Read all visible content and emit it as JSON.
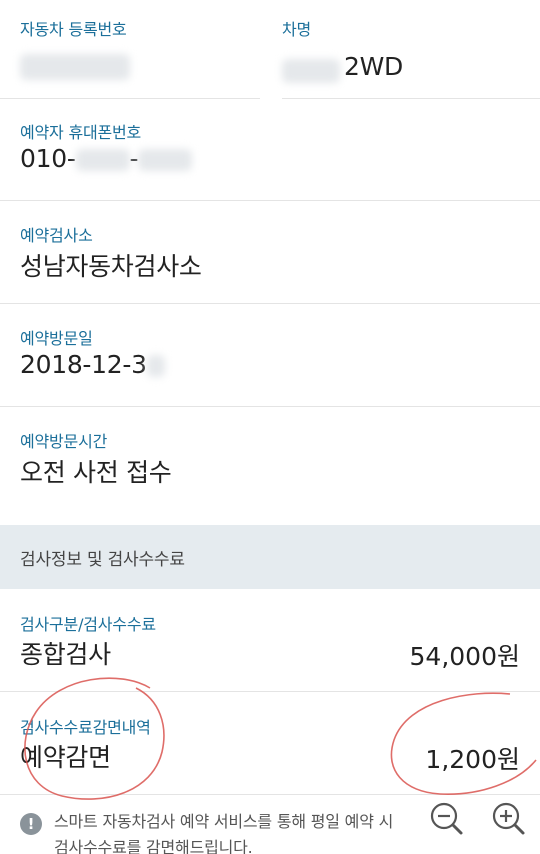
{
  "vehicle": {
    "reg_label": "자동차 등록번호",
    "name_label": "차명",
    "name_value": "2WD"
  },
  "phone": {
    "label": "예약자 휴대폰번호",
    "value_prefix": "010-",
    "value_mid": "-"
  },
  "center": {
    "label": "예약검사소",
    "value": "성남자동차검사소"
  },
  "visit_date": {
    "label": "예약방문일",
    "value": "2018-12-3"
  },
  "visit_time": {
    "label": "예약방문시간",
    "value": "오전 사전 접수"
  },
  "section": {
    "title": "검사정보 및 검사수수료"
  },
  "fee": {
    "label": "검사구분/검사수수료",
    "type": "종합검사",
    "amount": "54,000원"
  },
  "discount": {
    "label": "검사수수료감면내역",
    "type": "예약감면",
    "amount": "1,200원"
  },
  "notice": {
    "text_line1": "스마트 자동차검사 예약 서비스를 통해 평일 예약 시",
    "text_line2": "검사수수료를 감면해드립니다."
  },
  "icons": {
    "notice": "info-icon",
    "zoom_out": "zoom-out-icon",
    "zoom_in": "zoom-in-icon"
  },
  "colors": {
    "label": "#1b6f9a",
    "section_bg": "#e5ebef",
    "annotation": "#d9534f"
  }
}
